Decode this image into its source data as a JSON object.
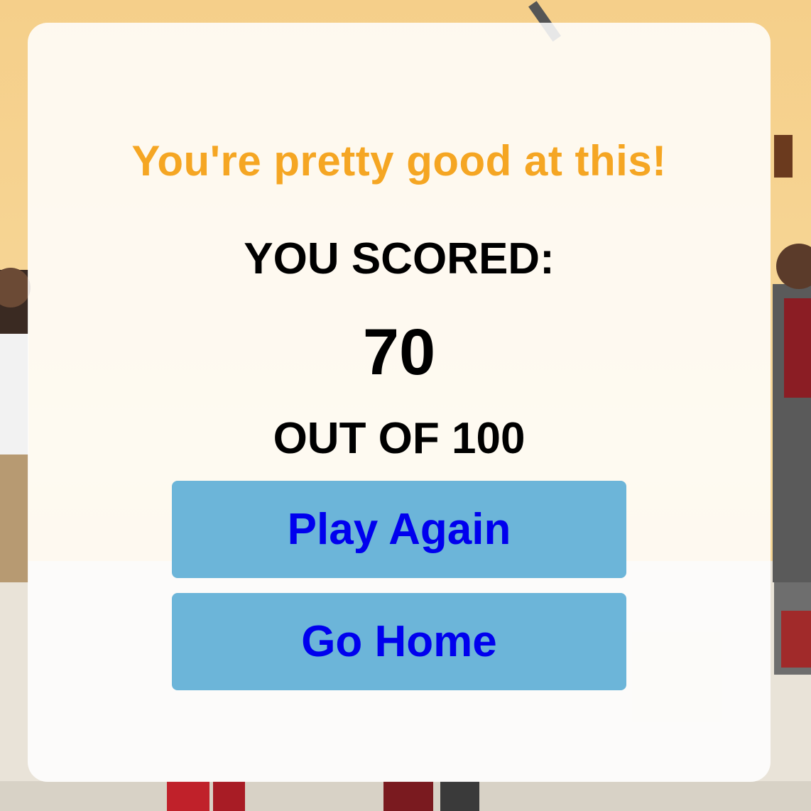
{
  "result": {
    "headline": "You're pretty good at this!",
    "scored_label": "YOU SCORED:",
    "score": "70",
    "total_label": "OUT OF 100"
  },
  "actions": {
    "play_again_label": "Play Again",
    "go_home_label": "Go Home"
  },
  "colors": {
    "headline": "#f5a623",
    "button_bg": "#6cb5d9",
    "button_text": "#0000ee",
    "background": "#f5cf8a"
  }
}
